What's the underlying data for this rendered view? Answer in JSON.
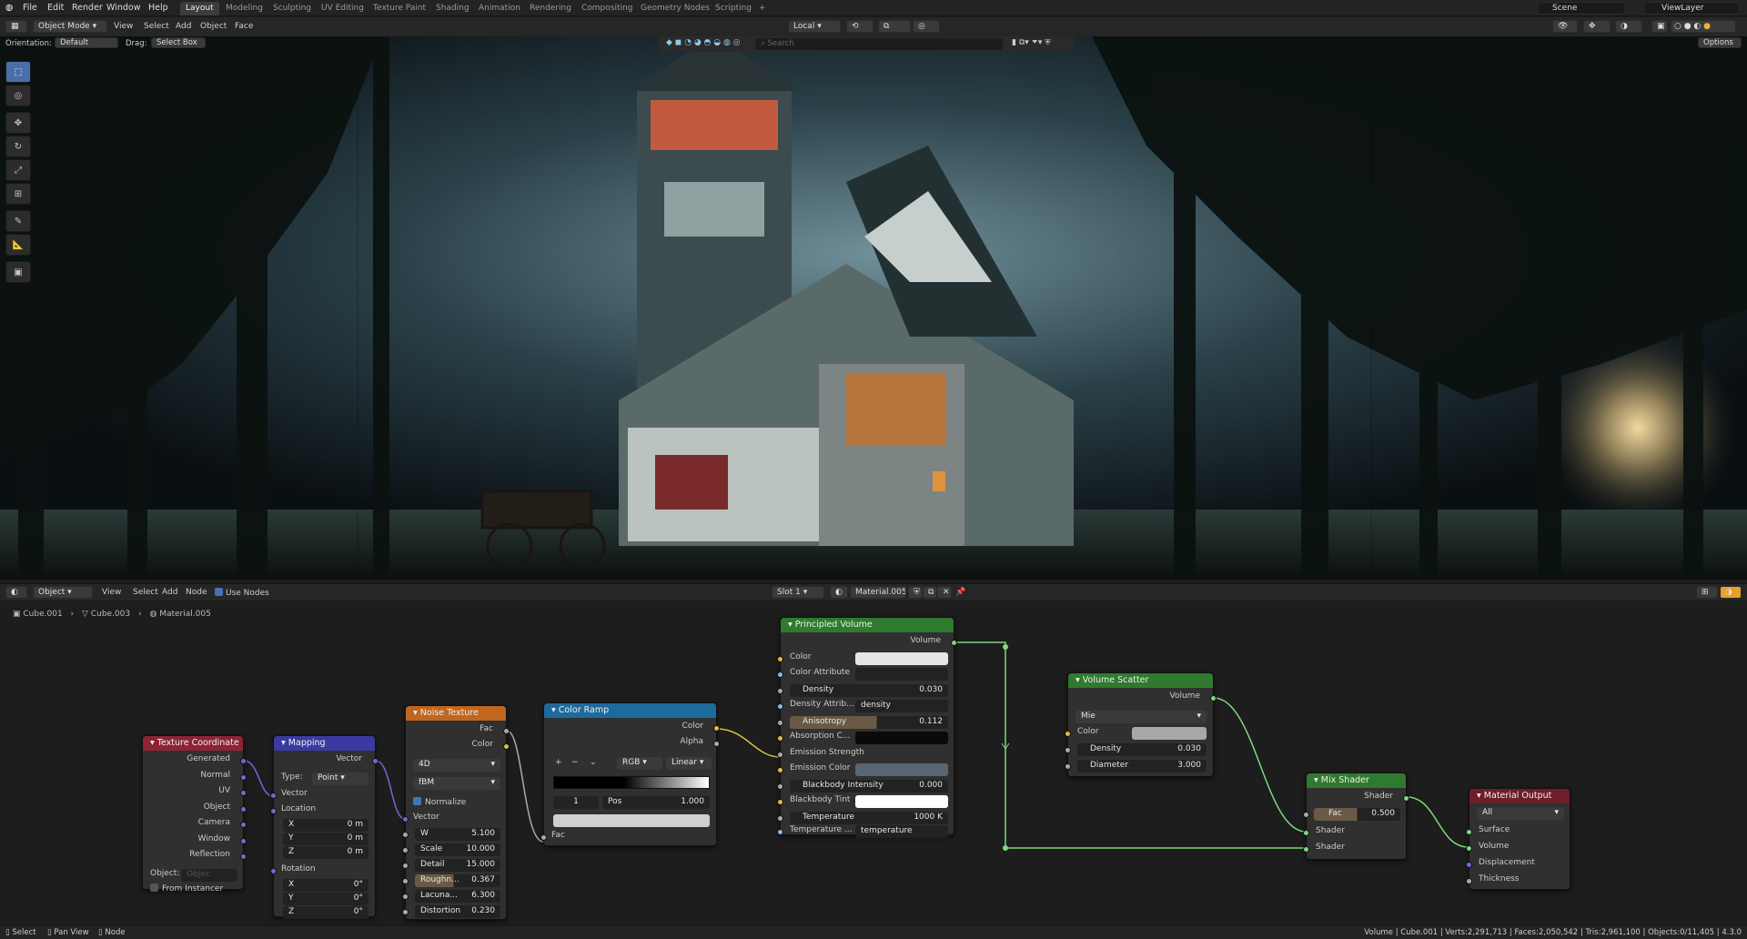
{
  "topbar": {
    "menu": [
      "File",
      "Edit",
      "Render",
      "Window",
      "Help"
    ],
    "workspaces": [
      "Layout",
      "Modeling",
      "Sculpting",
      "UV Editing",
      "Texture Paint",
      "Shading",
      "Animation",
      "Rendering",
      "Compositing",
      "Geometry Nodes",
      "Scripting"
    ],
    "scene": "Scene",
    "view_layer": "ViewLayer"
  },
  "viewport_header": {
    "mode": "Object Mode",
    "menu": [
      "View",
      "Select",
      "Add",
      "Object",
      "Face"
    ],
    "transform": "Local",
    "orientation_label": "Orientation:",
    "orientation": "Default",
    "drag_label": "Drag:",
    "drag": "Select Box",
    "options": "Options",
    "search_placeholder": "Search"
  },
  "node_header": {
    "type": "Object",
    "menu": [
      "View",
      "Select",
      "Add",
      "Node"
    ],
    "use_nodes": "Use Nodes",
    "slot": "Slot 1",
    "material": "Material.005"
  },
  "breadcrumb": [
    "Cube.001",
    "Cube.003",
    "Material.005"
  ],
  "nodes": {
    "tex_coord": {
      "title": "Texture Coordinate",
      "outputs": [
        "Generated",
        "Normal",
        "UV",
        "Object",
        "Camera",
        "Window",
        "Reflection"
      ],
      "object_label": "Object:",
      "object_placeholder": "Objec",
      "from_instancer": "From Instancer"
    },
    "mapping": {
      "title": "Mapping",
      "vector_out": "Vector",
      "type_label": "Type:",
      "type": "Point",
      "vector_in": "Vector",
      "location": "Location",
      "loc": [
        [
          "X",
          "0 m"
        ],
        [
          "Y",
          "0 m"
        ],
        [
          "Z",
          "0 m"
        ]
      ],
      "rotation": "Rotation",
      "rot": [
        [
          "X",
          "0°"
        ],
        [
          "Y",
          "0°"
        ],
        [
          "Z",
          "0°"
        ]
      ]
    },
    "noise": {
      "title": "Noise Texture",
      "fac": "Fac",
      "color": "Color",
      "dim": "4D",
      "type": "fBM",
      "normalize": "Normalize",
      "vector": "Vector",
      "fields": [
        [
          "W",
          "5.100"
        ],
        [
          "Scale",
          "10.000"
        ],
        [
          "Detail",
          "15.000"
        ],
        [
          "Roughn...",
          "0.367"
        ],
        [
          "Lacuna...",
          "6.300"
        ],
        [
          "Distortion",
          "0.230"
        ]
      ]
    },
    "ramp": {
      "title": "Color Ramp",
      "color": "Color",
      "alpha": "Alpha",
      "mode": "RGB",
      "interp": "Linear",
      "stop": "1",
      "pos_label": "Pos",
      "pos": "1.000",
      "fac": "Fac"
    },
    "principled": {
      "title": "Principled Volume",
      "volume": "Volume",
      "color": "Color",
      "color_attr": "Color Attribute",
      "density_label": "Density",
      "density": "0.030",
      "density_attr_label": "Density Attrib...",
      "density_attr": "density",
      "aniso_label": "Anisotropy",
      "aniso": "0.112",
      "absorption": "Absorption C...",
      "emission_strength": "Emission Strength",
      "emission_color": "Emission Color",
      "bb_label": "Blackbody Intensity",
      "bb": "0.000",
      "bb_tint": "Blackbody Tint",
      "temp_label": "Temperature",
      "temp": "1000 K",
      "temp_attr_label": "Temperature ...",
      "temp_attr": "temperature"
    },
    "scatter": {
      "title": "Volume Scatter",
      "volume": "Volume",
      "phase": "Mie",
      "color": "Color",
      "density_label": "Density",
      "density": "0.030",
      "diameter_label": "Diameter",
      "diameter": "3.000"
    },
    "mix": {
      "title": "Mix Shader",
      "shader_out": "Shader",
      "fac_label": "Fac",
      "fac": "0.500",
      "shader1": "Shader",
      "shader2": "Shader"
    },
    "output": {
      "title": "Material Output",
      "target": "All",
      "inputs": [
        "Surface",
        "Volume",
        "Displacement",
        "Thickness"
      ]
    }
  },
  "status": {
    "left": [
      "Select",
      "Pan View",
      "Node"
    ],
    "right": "Volume | Cube.001 | Verts:2,291,713 | Faces:2,050,542 | Tris:2,961,100 | Objects:0/11,405 | 4.3.0"
  },
  "colors": {
    "accent": "#4772b3",
    "tex_header": "#8c2436",
    "vector_header": "#3a3aa0",
    "texture_header": "#c0661f",
    "converter_header": "#1d6a9c",
    "shader_header": "#2f7a2f",
    "output_header": "#6e1e2a",
    "link": "#7fd77f"
  }
}
